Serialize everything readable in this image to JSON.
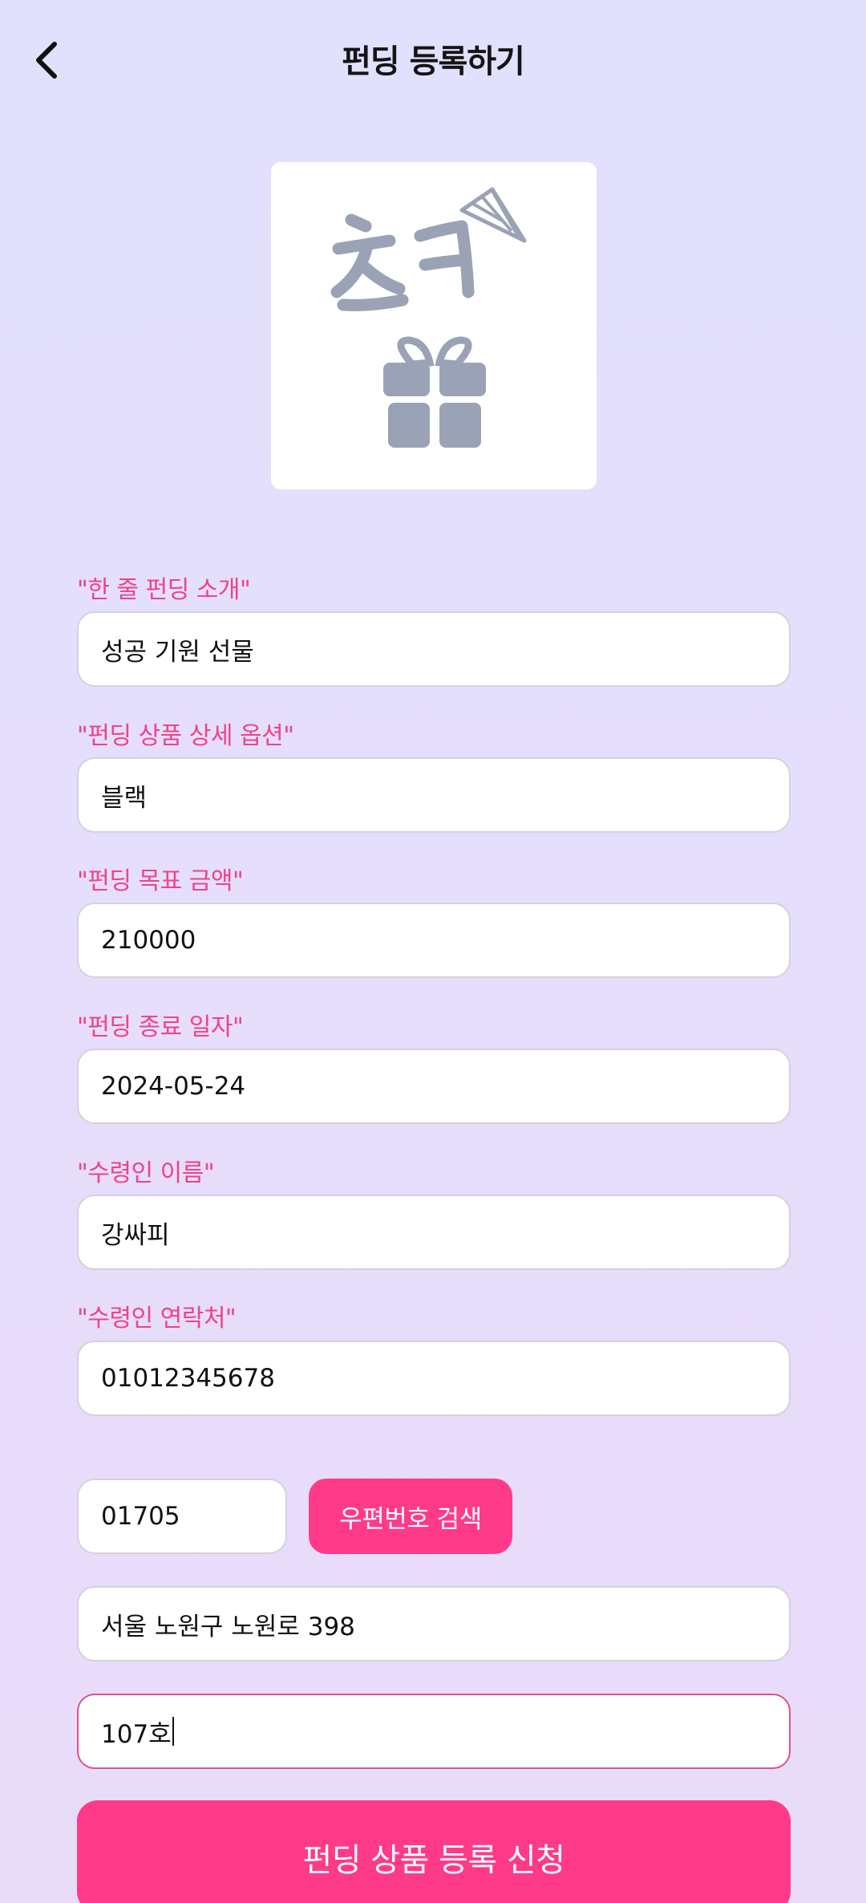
{
  "header": {
    "title": "펀딩 등록하기",
    "back_icon": "chevron-left-icon"
  },
  "product_image": {
    "logo_text": "ㅊㅋ",
    "icons": [
      "party-hat-icon",
      "gift-icon"
    ]
  },
  "form": {
    "intro": {
      "label": "\"한 줄 펀딩 소개\"",
      "value": "성공 기원 선물"
    },
    "option": {
      "label": "\"펀딩 상품 상세 옵션\"",
      "value": "블랙"
    },
    "goal": {
      "label": "\"펀딩 목표 금액\"",
      "value": "210000"
    },
    "end_date": {
      "label": "\"펀딩 종료 일자\"",
      "value": "2024-05-24"
    },
    "recipient_name": {
      "label": "\"수령인 이름\"",
      "value": "강싸피"
    },
    "recipient_phone": {
      "label": "\"수령인 연락처\"",
      "value": "01012345678"
    },
    "zipcode": {
      "value": "01705"
    },
    "zip_search_label": "우편번호 검색",
    "address": {
      "value": "서울 노원구 노원로 398"
    },
    "address_detail": {
      "value": "107호"
    }
  },
  "submit_label": "펀딩 상품 등록 신청",
  "colors": {
    "accent": "#ff3a89",
    "label": "#ef4388",
    "icon_gray": "#9aa3b5"
  }
}
